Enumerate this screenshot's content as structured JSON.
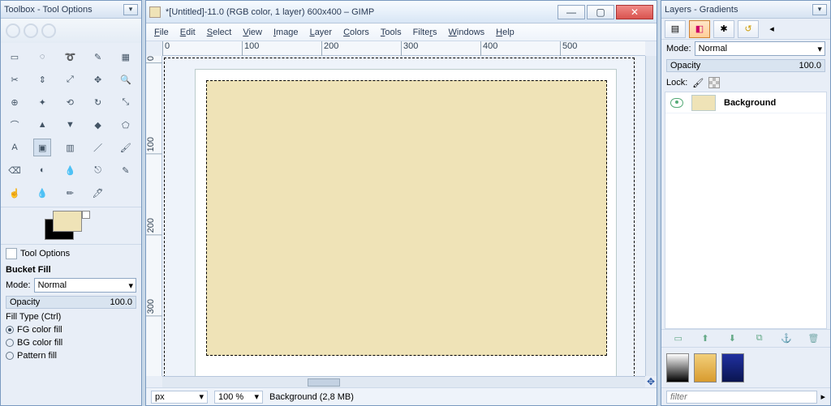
{
  "toolbox": {
    "title": "Toolbox - Tool Options",
    "tool_options_label": "Tool Options",
    "section_title": "Bucket Fill",
    "mode_label": "Mode:",
    "mode_value": "Normal",
    "opacity_label": "Opacity",
    "opacity_value": "100.0",
    "fill_type_label": "Fill Type  (Ctrl)",
    "fill_fg": "FG color fill",
    "fill_bg": "BG color fill",
    "fill_pattern": "Pattern fill",
    "swatch_fg": "#efe3b7",
    "swatch_bg": "#000000",
    "tools": [
      "▭",
      "◌",
      "➰",
      "✎",
      "▦",
      "✂",
      "⇕",
      "⤢",
      "✥",
      "🔍",
      "⊕",
      "✦",
      "⟲",
      "↻",
      "⤡",
      "⌒",
      "▲",
      "▼",
      "◆",
      "⬠",
      "A",
      "▣",
      "▥",
      "／",
      "🖌",
      "⌫",
      "◐",
      "💧",
      "⎋",
      "✎",
      "☝",
      "💧",
      "✏",
      "🖊"
    ]
  },
  "main_window": {
    "title": "*[Untitled]-11.0 (RGB color, 1 layer) 600x400 – GIMP",
    "menu": {
      "file": "File",
      "edit": "Edit",
      "select": "Select",
      "view": "View",
      "image": "Image",
      "layer": "Layer",
      "colors": "Colors",
      "tools": "Tools",
      "filters": "Filters",
      "windows": "Windows",
      "help": "Help"
    },
    "ruler_h": [
      "0",
      "100",
      "200",
      "300",
      "400",
      "500"
    ],
    "ruler_v": [
      "0",
      "100",
      "200",
      "300"
    ],
    "status_unit": "px",
    "status_zoom": "100 %",
    "status_layer": "Background (2,8 MB)",
    "canvas_fill": "#efe3b7"
  },
  "layers": {
    "title": "Layers - Gradients",
    "mode_label": "Mode:",
    "mode_value": "Normal",
    "opacity_label": "Opacity",
    "opacity_value": "100.0",
    "lock_label": "Lock:",
    "layer_name": "Background",
    "filter_placeholder": "filter",
    "gradients": [
      "linear-gradient(#fff,#000)",
      "linear-gradient(#f2cf7a,#d89b2e)",
      "linear-gradient(#2030a0,#0a1550)"
    ]
  }
}
